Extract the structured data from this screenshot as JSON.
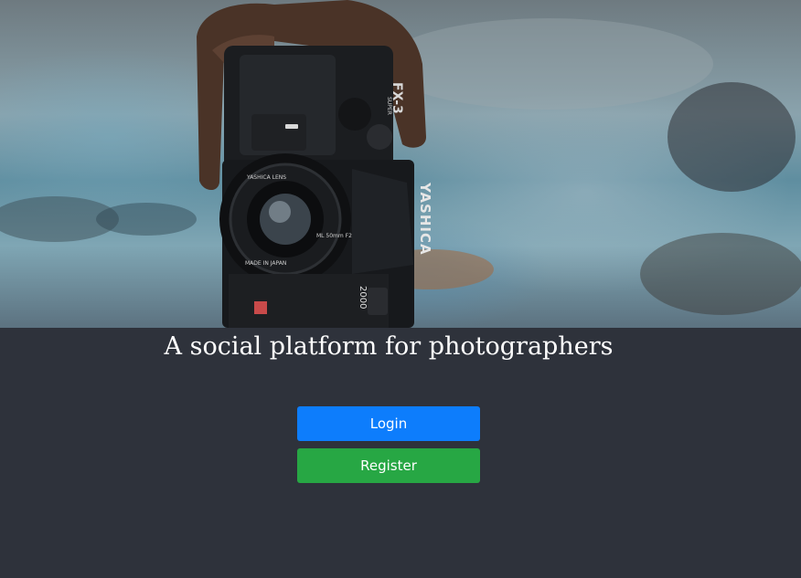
{
  "hero": {
    "camera_brand": "YASHICA",
    "camera_model": "FX-3",
    "camera_model_suffix": "SUPER",
    "camera_number": "2000",
    "lens_label": "YASHICA LENS",
    "lens_spec": "ML 50mm F2",
    "lens_origin": "MADE IN JAPAN"
  },
  "main": {
    "tagline": "A social platform for photographers",
    "login_label": "Login",
    "register_label": "Register"
  },
  "colors": {
    "background": "#2e323b",
    "login": "#0d7dfc",
    "register": "#27a744"
  }
}
